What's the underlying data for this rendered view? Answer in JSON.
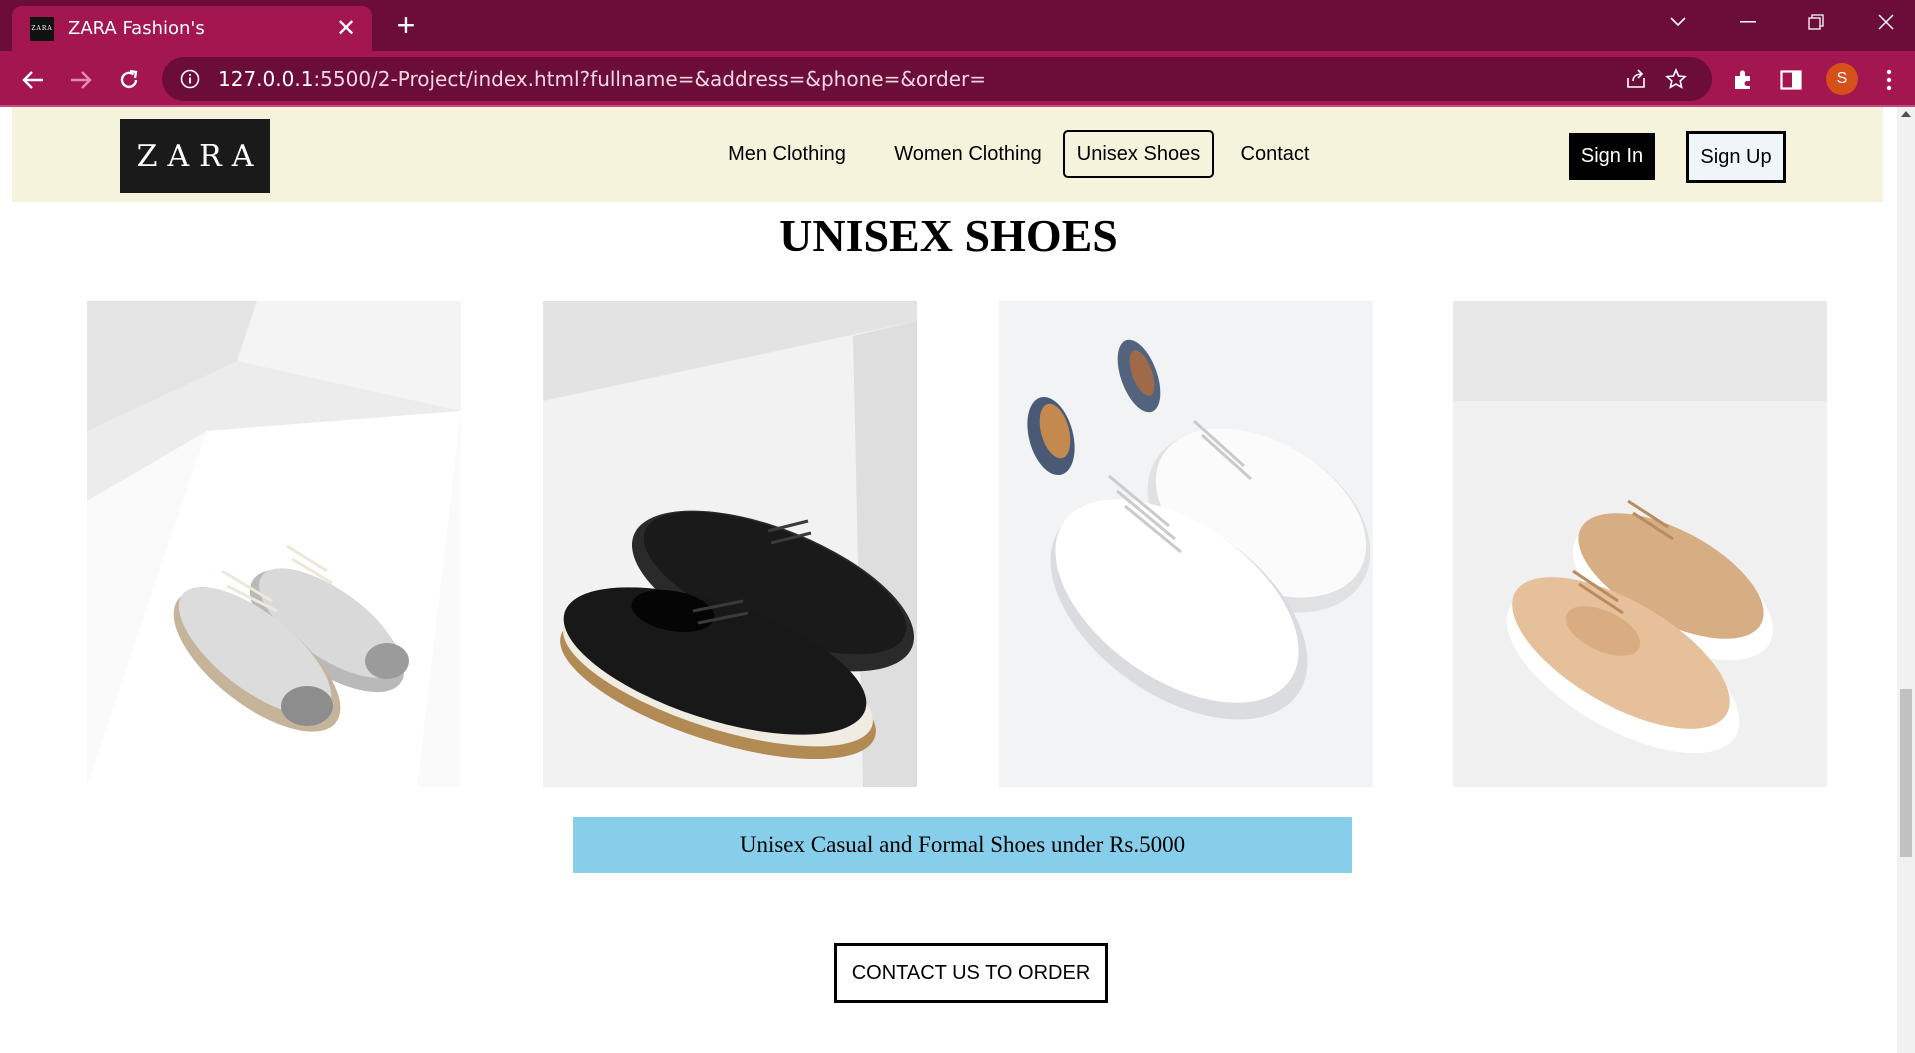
{
  "browser": {
    "tab_title": "ZARA Fashion's",
    "tab_favicon_text": "ZARA",
    "url_host": "127.0.0.1",
    "url_rest": ":5500/2-Project/index.html?fullname=&address=&phone=&order=",
    "profile_initial": "S",
    "accent_color": "#a4164f"
  },
  "header": {
    "logo": "ZARA",
    "nav": [
      {
        "label": "Men Clothing",
        "active": false
      },
      {
        "label": "Women Clothing",
        "active": false
      },
      {
        "label": "Unisex Shoes",
        "active": true
      },
      {
        "label": "Contact",
        "active": false
      }
    ],
    "signin_label": "Sign In",
    "signup_label": "Sign Up",
    "background_color": "#f5f3dc"
  },
  "main": {
    "title": "UNISEX SHOES",
    "products": [
      {
        "image": "silver-metallic-oxford-shoes"
      },
      {
        "image": "black-perforated-derby-shoes"
      },
      {
        "image": "white-sneakers-floral-heel"
      },
      {
        "image": "nude-platform-oxford-shoes"
      }
    ],
    "promo_text": "Unisex Casual and Formal Shoes under Rs.5000",
    "promo_color": "#87ceeb",
    "cta_label": "CONTACT US TO ORDER"
  }
}
